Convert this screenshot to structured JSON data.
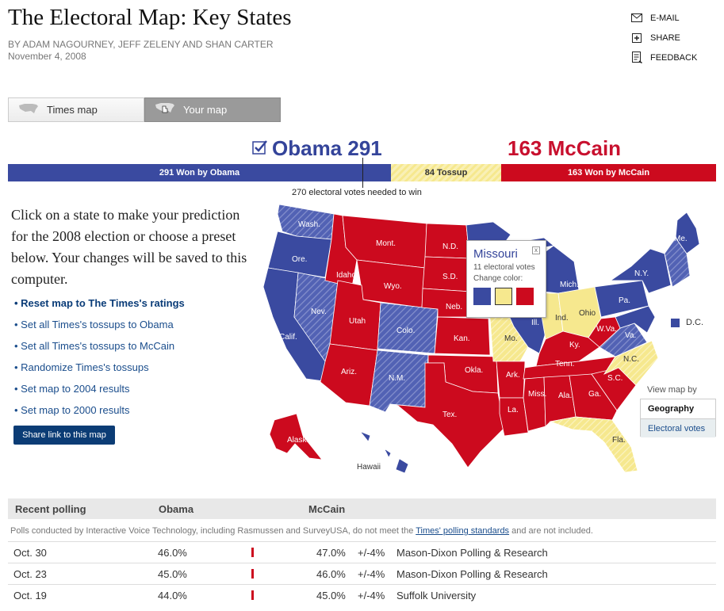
{
  "header": {
    "title": "The Electoral Map: Key States",
    "byline": "By ADAM NAGOURNEY, JEFF ZELENY AND SHAN CARTER",
    "date": "November 4, 2008"
  },
  "tools": [
    {
      "label": "E-MAIL",
      "icon": "envelope-icon"
    },
    {
      "label": "SHARE",
      "icon": "plus-box-icon"
    },
    {
      "label": "FEEDBACK",
      "icon": "document-icon"
    }
  ],
  "tabs": [
    {
      "label": "Times map",
      "active": false
    },
    {
      "label": "Your map",
      "active": true
    }
  ],
  "totals": {
    "obama_headline": "Obama 291",
    "mccain_headline": "163 McCain",
    "obama_votes": 291,
    "tossup_votes": 84,
    "mccain_votes": 163,
    "obama_label": "291 Won by Obama",
    "tossup_label": "84 Tossup",
    "mccain_label": "163 Won by McCain",
    "needed": "270 electoral votes needed to win"
  },
  "intro": "Click on a state to make your prediction for the 2008 election or choose a preset below. Your changes will be saved to this computer.",
  "presets": [
    "Reset map to The Times's ratings",
    "Set all Times's tossups to Obama",
    "Set all Times's tossups to McCain",
    "Randomize Times's tossups",
    "Set map to 2004 results",
    "Set map to 2000 results"
  ],
  "share_label": "Share link to this map",
  "map": {
    "labels": {
      "wa": "Wash.",
      "or": "Ore.",
      "ca": "Calif.",
      "id": "Idaho",
      "nv": "Nev.",
      "mt": "Mont.",
      "wy": "Wyo.",
      "ut": "Utah",
      "az": "Ariz.",
      "co": "Colo.",
      "nm": "N.M.",
      "nd": "N.D.",
      "sd": "S.D.",
      "ne": "Neb.",
      "ks": "Kan.",
      "ok": "Okla.",
      "tx": "Tex.",
      "mo": "Mo.",
      "ar": "Ark.",
      "la": "La.",
      "il": "Ill.",
      "mi": "Mich.",
      "ind": "Ind.",
      "oh": "Ohio",
      "ky": "Ky.",
      "tn": "Tenn.",
      "ms": "Miss.",
      "al": "Ala.",
      "ga": "Ga.",
      "fl": "Fla.",
      "sc": "S.C.",
      "nc": "N.C.",
      "va": "Va.",
      "wv": "W.Va.",
      "pa": "Pa.",
      "ny": "N.Y.",
      "me": "Me.",
      "ak": "Alaska",
      "hi": "Hawaii"
    },
    "dc_label": "D.C.",
    "colors": {
      "obama": "#3a4aa0",
      "mccain": "#cc0a1e",
      "tossup": "#f6e88e"
    }
  },
  "popup": {
    "state": "Missouri",
    "votes": "11 electoral votes",
    "change": "Change color:",
    "close": "x"
  },
  "view": {
    "title": "View map by",
    "options": [
      "Geography",
      "Electoral votes"
    ],
    "selected": "Geography"
  },
  "polling": {
    "headers": [
      "Recent polling",
      "Obama",
      "McCain"
    ],
    "note_before": "Polls conducted by Interactive Voice Technology, including Rasmussen and SurveyUSA, do not meet the",
    "note_link": "Times' polling standards",
    "note_after": "and are not included.",
    "rows": [
      {
        "date": "Oct. 30",
        "obama": "46.0%",
        "mccain": "47.0%",
        "margin": "+/-4%",
        "pollster": "Mason-Dixon Polling & Research"
      },
      {
        "date": "Oct. 23",
        "obama": "45.0%",
        "mccain": "46.0%",
        "margin": "+/-4%",
        "pollster": "Mason-Dixon Polling & Research"
      },
      {
        "date": "Oct. 19",
        "obama": "44.0%",
        "mccain": "45.0%",
        "margin": "+/-4%",
        "pollster": "Suffolk University"
      }
    ]
  }
}
